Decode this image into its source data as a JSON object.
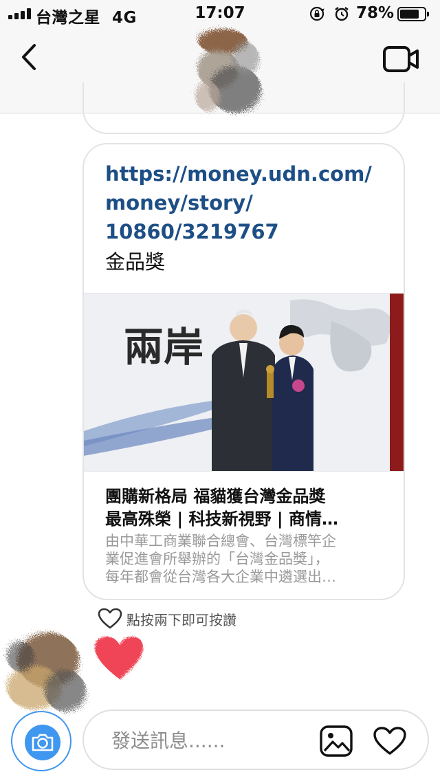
{
  "status_bar": {
    "carrier": "台灣之星",
    "network": "4G",
    "time": "17:07",
    "battery_percent": "78%",
    "battery_level": 0.78,
    "icons": [
      "signal-icon",
      "orientation-lock-icon",
      "alarm-icon",
      "battery-icon"
    ]
  },
  "header": {
    "icons": [
      "back-icon",
      "contact-avatar",
      "video-call-icon"
    ]
  },
  "messages": {
    "link_card": {
      "url_lines": [
        "https://money.udn.com/",
        "money/story/",
        "10860/3219767"
      ],
      "note": "金品獎",
      "preview_title_lines": [
        "團購新格局 福貓獲台灣金品獎",
        "最高殊榮 | 科技新視野 | 商情…"
      ],
      "preview_description_lines": [
        "由中華工商業聯合總會、台灣標竿企",
        "業促進會所舉辦的「台灣金品獎」，",
        "每年都會從台灣各大企業中遴選出…"
      ]
    },
    "like_hint": "點按兩下即可按讚",
    "sent_reaction": "heart-icon"
  },
  "composer": {
    "placeholder": "發送訊息......",
    "icons": [
      "camera-icon",
      "gallery-icon",
      "heart-icon"
    ]
  },
  "colors": {
    "link": "#1d4f86",
    "accent_blue": "#3f97ef",
    "heart_red": "#ef4456",
    "bubble_border": "#e3e3e3"
  }
}
